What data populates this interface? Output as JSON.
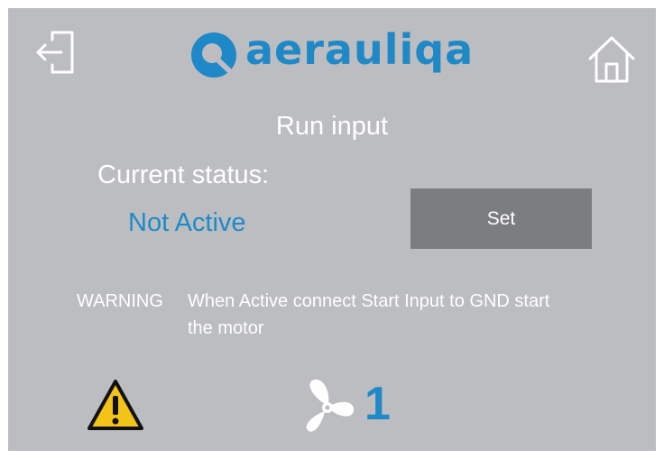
{
  "header": {
    "logo_text": "aerauliqa",
    "exit_icon": "exit-icon",
    "home_icon": "home-icon",
    "brand_color": "#1f88c6"
  },
  "main": {
    "title": "Run input",
    "status_label": "Current status:",
    "status_value": "Not Active",
    "set_label": "Set",
    "warning_label": "WARNING",
    "warning_text": "When Active connect Start Input to GND start the motor"
  },
  "footer": {
    "warning_icon": "warning-triangle-icon",
    "fan_icon": "fan-icon",
    "fan_speed": "1"
  }
}
